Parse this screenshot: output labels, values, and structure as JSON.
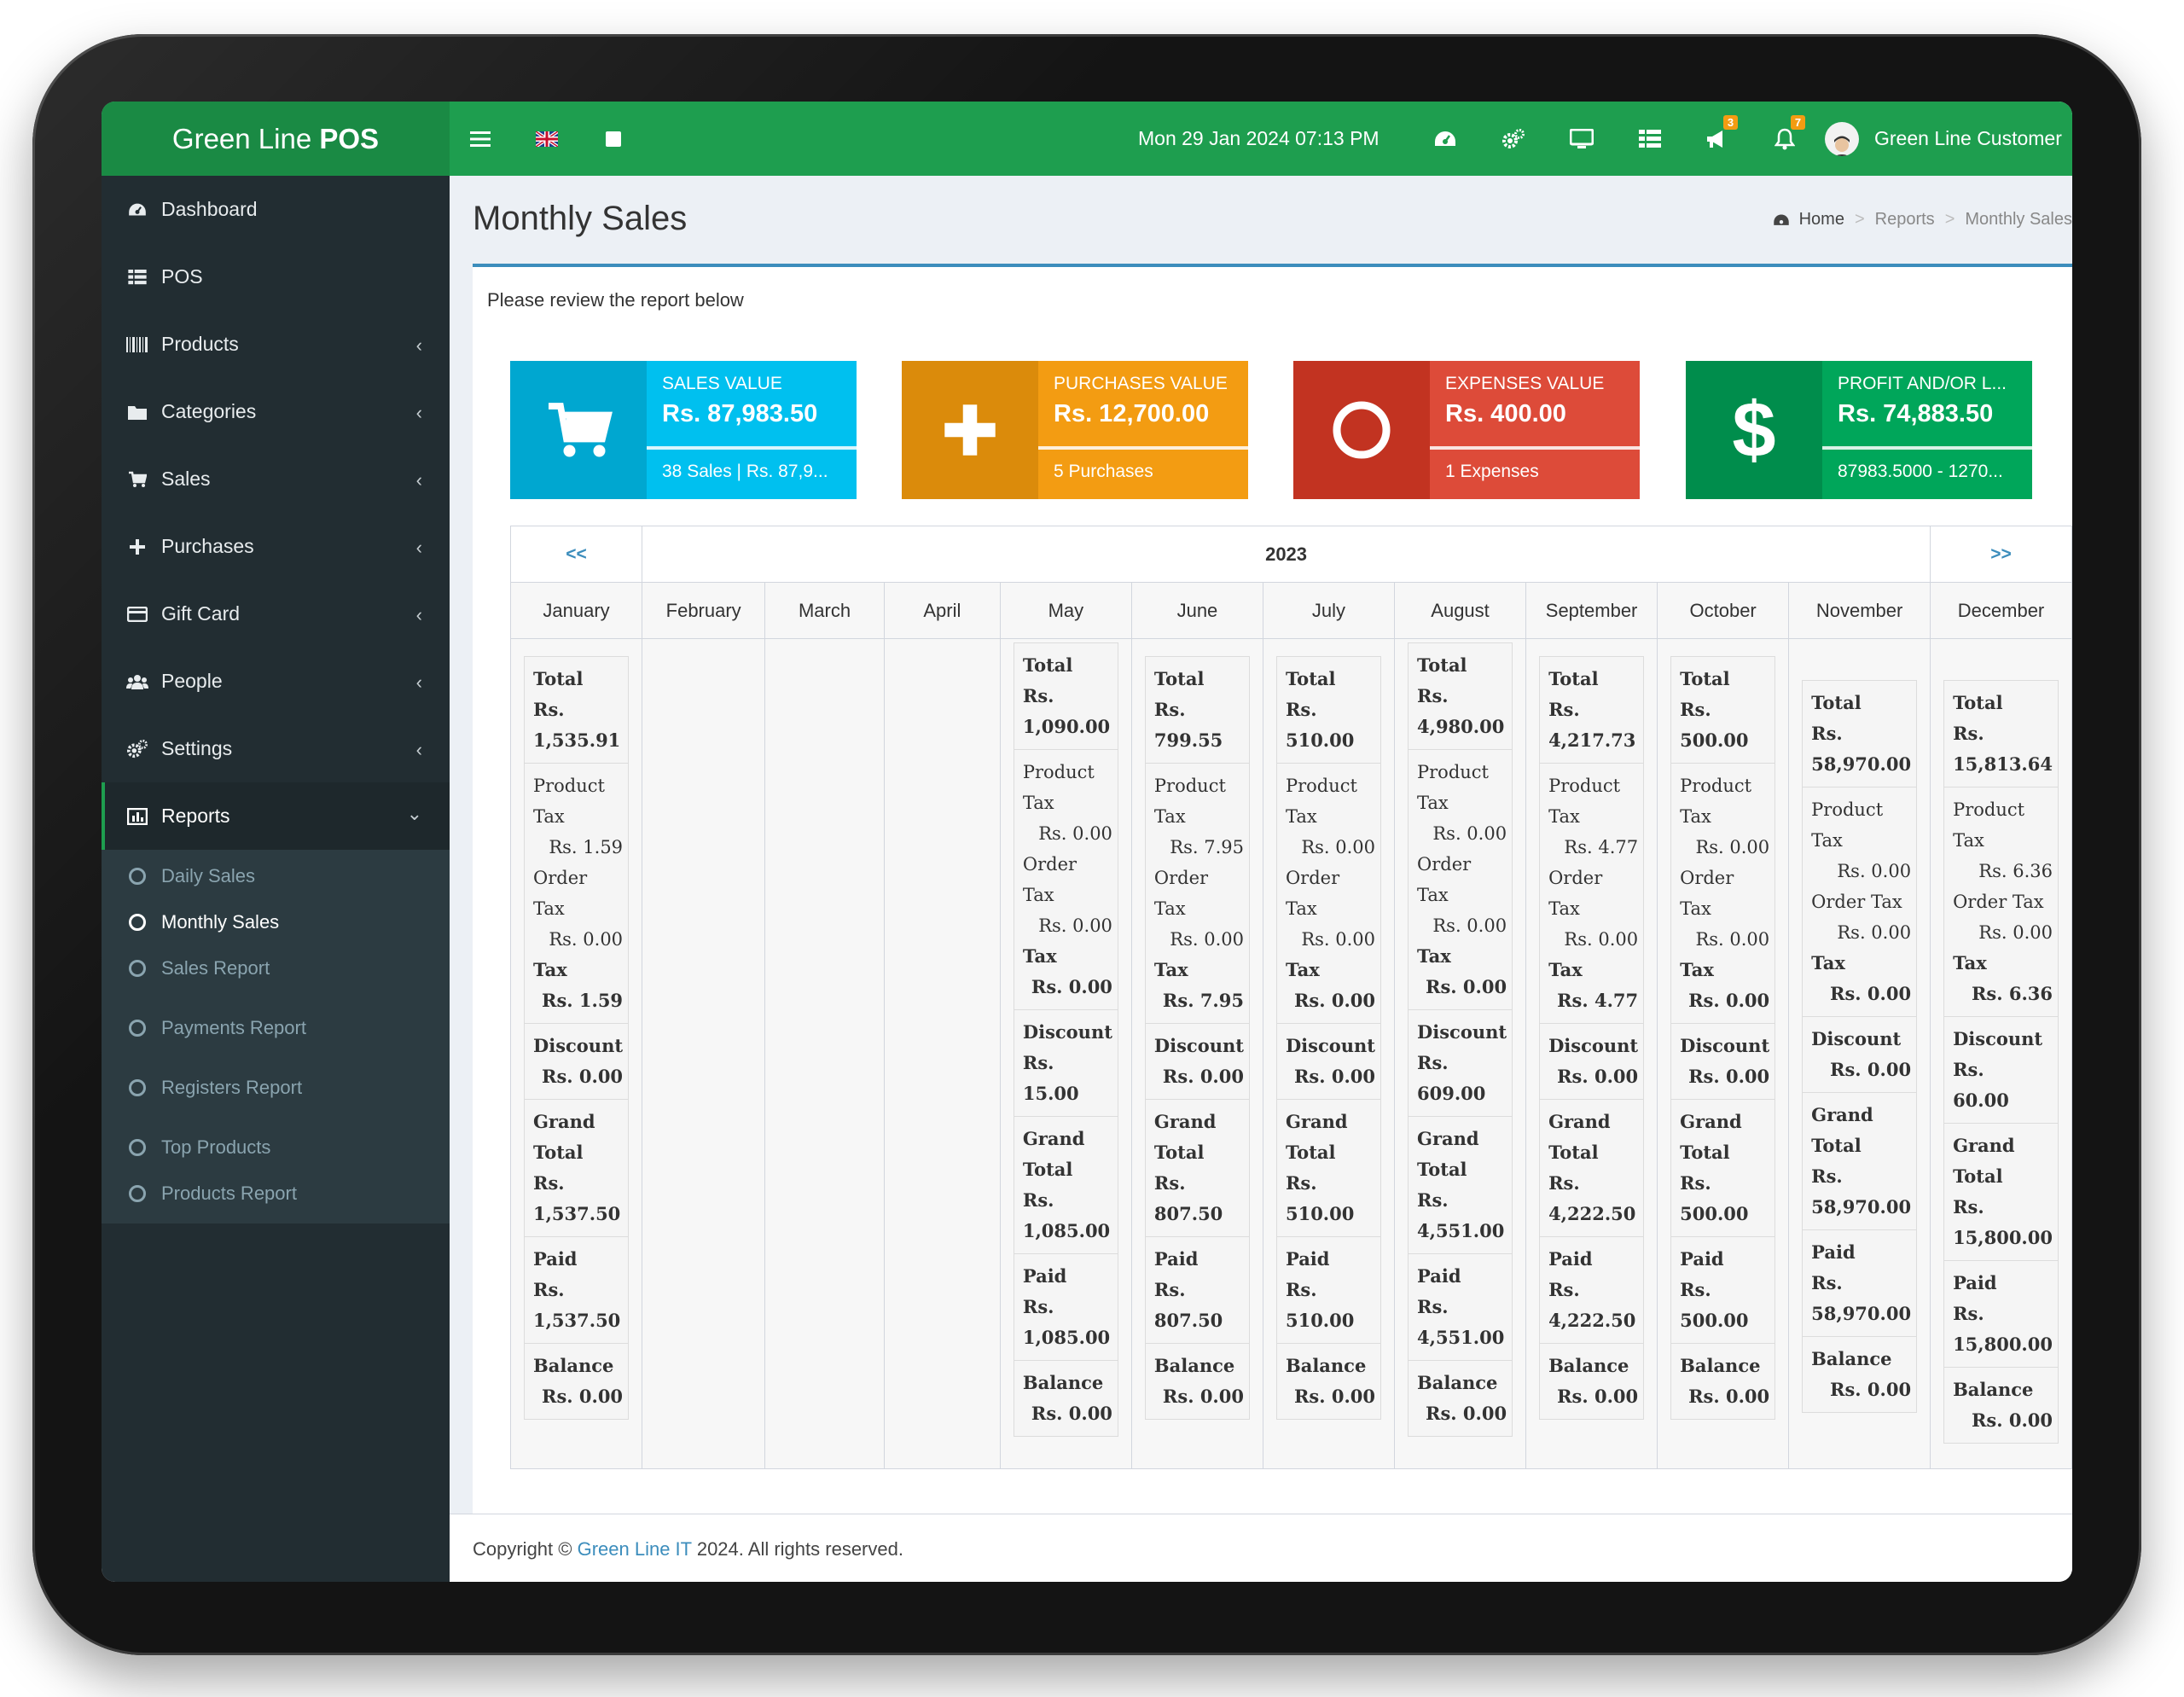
{
  "app": {
    "brand_light": "Green Line ",
    "brand_bold": "POS"
  },
  "topbar": {
    "datetime": "Mon 29 Jan 2024 07:13 PM",
    "notification_count_1": "3",
    "notification_count_2": "7",
    "user_name": "Green Line Customer",
    "colors": {
      "bar": "#1e9e4f",
      "logo": "#1a8a44"
    }
  },
  "sidebar": {
    "items": [
      {
        "label": "Dashboard",
        "icon": "dashboard-icon"
      },
      {
        "label": "POS",
        "icon": "grid-icon"
      },
      {
        "label": "Products",
        "icon": "barcode-icon"
      },
      {
        "label": "Categories",
        "icon": "folder-icon"
      },
      {
        "label": "Sales",
        "icon": "cart-icon"
      },
      {
        "label": "Purchases",
        "icon": "plus-icon"
      },
      {
        "label": "Gift Card",
        "icon": "credit-card-icon"
      },
      {
        "label": "People",
        "icon": "users-icon"
      },
      {
        "label": "Settings",
        "icon": "gears-icon"
      },
      {
        "label": "Reports",
        "icon": "bar-chart-icon"
      }
    ],
    "reports_sub": [
      {
        "label": "Daily Sales"
      },
      {
        "label": "Monthly Sales"
      },
      {
        "label": "Sales Report"
      },
      {
        "label": "Payments Report"
      },
      {
        "label": "Registers Report"
      },
      {
        "label": "Top Products"
      },
      {
        "label": "Products Report"
      }
    ]
  },
  "page": {
    "title": "Monthly Sales",
    "breadcrumb": {
      "home": "Home",
      "reports": "Reports",
      "current": "Monthly Sales"
    },
    "intro": "Please review the report below"
  },
  "tiles": [
    {
      "label": "SALES VALUE",
      "value": "Rs. 87,983.50",
      "foot": "38 Sales | Rs. 87,9...",
      "color": "#00c0ef",
      "icon_bg": "#00a7d0",
      "icon": "cart-icon"
    },
    {
      "label": "PURCHASES VALUE",
      "value": "Rs. 12,700.00",
      "foot": "5 Purchases",
      "color": "#f39c12",
      "icon_bg": "#db8b0b",
      "icon": "plus-icon"
    },
    {
      "label": "EXPENSES VALUE",
      "value": "Rs. 400.00",
      "foot": "1 Expenses",
      "color": "#dd4b39",
      "icon_bg": "#c23321",
      "icon": "circle-icon"
    },
    {
      "label": "PROFIT AND/OR L...",
      "value": "Rs. 74,883.50",
      "foot": "87983.5000 - 1270...",
      "color": "#00a65a",
      "icon_bg": "#008d4c",
      "icon": "dollar-icon"
    }
  ],
  "calendar": {
    "prev": "<<",
    "next": ">>",
    "year": "2023",
    "months": [
      "January",
      "February",
      "March",
      "April",
      "May",
      "June",
      "July",
      "August",
      "September",
      "October",
      "November",
      "December"
    ],
    "data": {
      "January": {
        "total": "Rs. 1,535.91",
        "product_tax": "Rs. 1.59",
        "order_tax": "Rs. 0.00",
        "tax": "Rs. 1.59",
        "discount": "Rs. 0.00",
        "grand_total": "Rs. 1,537.50",
        "paid": "Rs. 1,537.50",
        "balance": "Rs. 0.00"
      },
      "May": {
        "total": "Rs. 1,090.00",
        "product_tax": "Rs. 0.00",
        "order_tax": "Rs. 0.00",
        "tax": "Rs. 0.00",
        "discount": "Rs. 15.00",
        "grand_total": "Rs. 1,085.00",
        "paid": "Rs. 1,085.00",
        "balance": "Rs. 0.00"
      },
      "June": {
        "total": "Rs. 799.55",
        "product_tax": "Rs. 7.95",
        "order_tax": "Rs. 0.00",
        "tax": "Rs. 7.95",
        "discount": "Rs. 0.00",
        "grand_total": "Rs. 807.50",
        "paid": "Rs. 807.50",
        "balance": "Rs. 0.00"
      },
      "July": {
        "total": "Rs. 510.00",
        "product_tax": "Rs. 0.00",
        "order_tax": "Rs. 0.00",
        "tax": "Rs. 0.00",
        "discount": "Rs. 0.00",
        "grand_total": "Rs. 510.00",
        "paid": "Rs. 510.00",
        "balance": "Rs. 0.00"
      },
      "August": {
        "total": "Rs. 4,980.00",
        "product_tax": "Rs. 0.00",
        "order_tax": "Rs. 0.00",
        "tax": "Rs. 0.00",
        "discount": "Rs. 609.00",
        "grand_total": "Rs. 4,551.00",
        "paid": "Rs. 4,551.00",
        "balance": "Rs. 0.00"
      },
      "September": {
        "total": "Rs. 4,217.73",
        "product_tax": "Rs. 4.77",
        "order_tax": "Rs. 0.00",
        "tax": "Rs. 4.77",
        "discount": "Rs. 0.00",
        "grand_total": "Rs. 4,222.50",
        "paid": "Rs. 4,222.50",
        "balance": "Rs. 0.00"
      },
      "October": {
        "total": "Rs. 500.00",
        "product_tax": "Rs. 0.00",
        "order_tax": "Rs. 0.00",
        "tax": "Rs. 0.00",
        "discount": "Rs. 0.00",
        "grand_total": "Rs. 500.00",
        "paid": "Rs. 500.00",
        "balance": "Rs. 0.00"
      },
      "November": {
        "total": "Rs. 58,970.00",
        "product_tax": "Rs. 0.00",
        "order_tax": "Rs. 0.00",
        "tax": "Rs. 0.00",
        "discount": "Rs. 0.00",
        "grand_total": "Rs. 58,970.00",
        "paid": "Rs. 58,970.00",
        "balance": "Rs. 0.00"
      },
      "December": {
        "total": "Rs. 15,813.64",
        "product_tax": "Rs. 6.36",
        "order_tax": "Rs. 0.00",
        "tax": "Rs. 6.36",
        "discount": "Rs. 60.00",
        "grand_total": "Rs. 15,800.00",
        "paid": "Rs. 15,800.00",
        "balance": "Rs. 0.00"
      }
    },
    "labels": {
      "total": "Total",
      "product": "Product",
      "tax_word": "Tax",
      "order": "Order",
      "order_tax": "Order Tax",
      "tax": "Tax",
      "discount": "Discount",
      "grand": "Grand",
      "grand_total": "Total",
      "paid": "Paid",
      "balance": "Balance"
    }
  },
  "footer": {
    "prefix": "Copyright © ",
    "link": "Green Line IT",
    "suffix": " 2024. All rights reserved."
  }
}
